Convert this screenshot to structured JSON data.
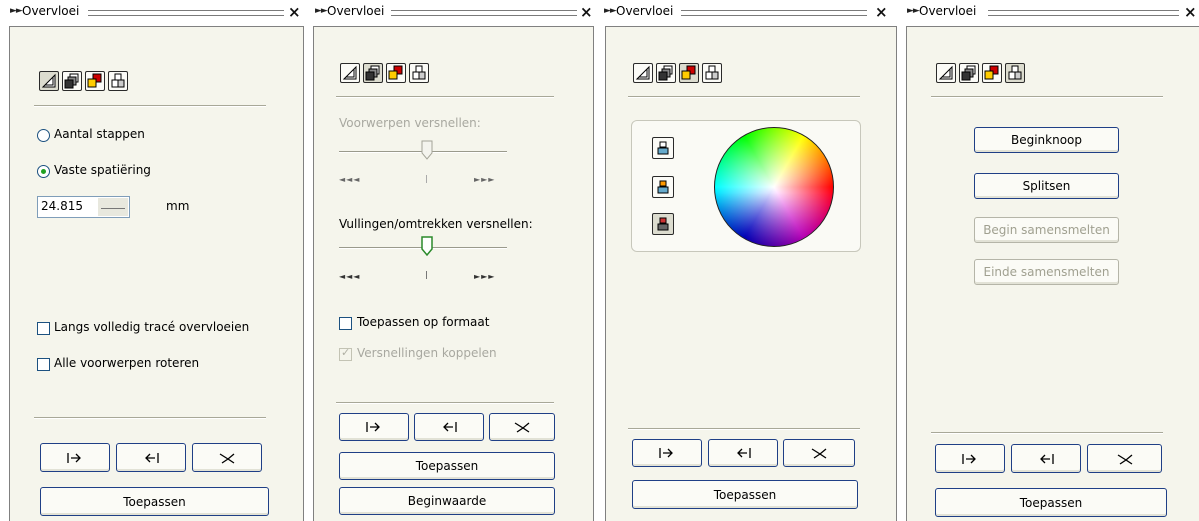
{
  "panels": [
    {
      "title": "Overvloei"
    },
    {
      "title": "Overvloei"
    },
    {
      "title": "Overvloei"
    },
    {
      "title": "Overvloei"
    }
  ],
  "steps_panel": {
    "radio_steps_label": "Aantal stappen",
    "radio_spacing_label": "Vaste spatiëring",
    "spacing_value": "24.815",
    "unit": "mm",
    "check_full_path": "Langs volledig tracé overvloeien",
    "check_rotate_all": "Alle voorwerpen roteren",
    "apply_label": "Toepassen"
  },
  "accel_panel": {
    "objects_accel_label": "Voorwerpen versnellen:",
    "fills_accel_label": "Vullingen/omtrekken versnellen:",
    "slider_left_label": "◄◄◄",
    "slider_right_label": "►►►",
    "check_apply_size": "Toepassen op formaat",
    "check_link_accel": "Versnellingen koppelen",
    "apply_label": "Toepassen",
    "default_label": "Beginwaarde"
  },
  "color_panel": {
    "apply_label": "Toepassen"
  },
  "misc_panel": {
    "start_node": "Beginknoop",
    "split": "Splitsen",
    "fuse_start": "Begin samensmelten",
    "fuse_end": "Einde samensmelten",
    "apply_label": "Toepassen"
  },
  "colors": {
    "panel_bg": "#f5f5ec",
    "button_border": "#1f3f86",
    "disabled_text": "#a0a090"
  },
  "icons": [
    "steps-icon",
    "acceleration-icon",
    "color-icon",
    "misc-icon",
    "direct-path-icon",
    "clockwise-path-icon",
    "counterclockwise-path-icon",
    "copy-properties-icon",
    "copy-blend-icon",
    "dismiss-blend-icon"
  ]
}
